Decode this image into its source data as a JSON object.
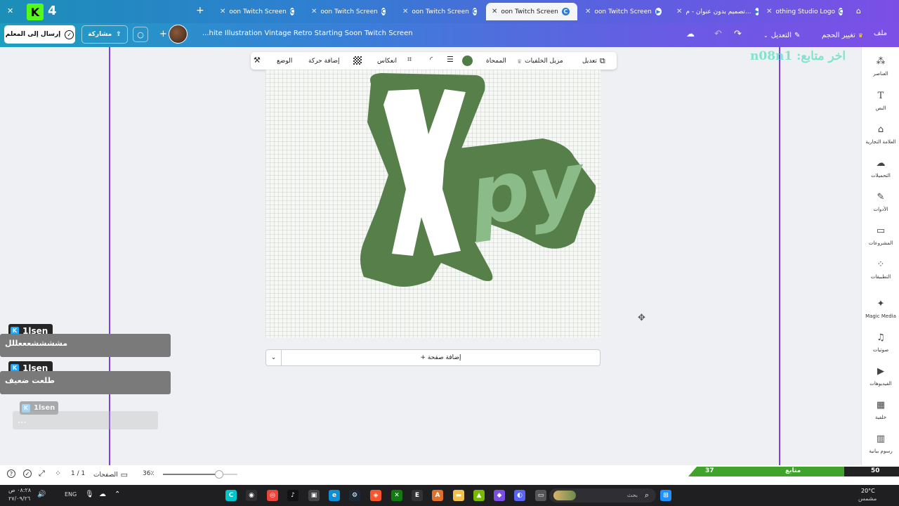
{
  "browser": {
    "counter": "4",
    "new_tab": "+",
    "tabs": [
      {
        "label": "oon Twitch Screen",
        "active": false
      },
      {
        "label": "oon Twitch Screen",
        "active": false
      },
      {
        "label": "oon Twitch Screen",
        "active": false
      },
      {
        "label": "oon Twitch Screen",
        "active": true
      },
      {
        "label": "oon Twitch Screen",
        "active": false
      },
      {
        "label": "تصميم بدون عنوان - م...",
        "active": false
      },
      {
        "label": "othing Studio Logo",
        "active": false
      }
    ]
  },
  "toolbar": {
    "file": "ملف",
    "resize": "تغيير الحجم",
    "edit": "التعديل",
    "doc_title": "...hite Illustration Vintage Retro Starting Soon Twitch Screen",
    "share": "مشاركة",
    "send_to_teacher": "إرسال إلى المعلم"
  },
  "context_toolbar": {
    "edit": "تعديل",
    "bg_remover": "مزيل الخلفيات",
    "eraser": "الممحاة",
    "flip": "انعكاس",
    "animate": "إضافة حركة",
    "position": "الوضع",
    "color": "#4f7d45"
  },
  "canvas": {
    "logo_letter": "X",
    "logo_text": "py",
    "logo_color": "#567f4a",
    "logo_light": "#8bbb88"
  },
  "add_page": "+ إضافة صفحة",
  "watermark": "n08n1 :اخر متابع",
  "chat": [
    {
      "user": "1lsen",
      "message": "مششششعععللل"
    },
    {
      "user": "1lsen",
      "message": "طلعت ضعيف"
    },
    {
      "user": "1lsen",
      "message": "..."
    }
  ],
  "sidebar": [
    {
      "label": "العناصر",
      "icon": "elements-icon"
    },
    {
      "label": "النص",
      "icon": "text-icon"
    },
    {
      "label": "العلامة التجارية",
      "icon": "brand-icon"
    },
    {
      "label": "التحميلات",
      "icon": "uploads-icon"
    },
    {
      "label": "الأدوات",
      "icon": "tools-icon"
    },
    {
      "label": "المشروعات",
      "icon": "projects-icon"
    },
    {
      "label": "التطبيقات",
      "icon": "apps-icon"
    },
    {
      "label": "Magic Media",
      "icon": "magic-media-icon"
    },
    {
      "label": "صوتيات",
      "icon": "audio-icon"
    },
    {
      "label": "الفيديوهات",
      "icon": "videos-icon"
    },
    {
      "label": "خلفية",
      "icon": "background-icon"
    },
    {
      "label": "رسوم بيانية",
      "icon": "charts-icon"
    }
  ],
  "status": {
    "zoom": "36٪",
    "zoom_fraction": 0.36,
    "pages_label": "الصفحات",
    "page_count": "1 / 1"
  },
  "followers": {
    "current": "37",
    "label": "متابع",
    "goal": "50",
    "progress": 0.74
  },
  "taskbar": {
    "search": "بحث",
    "lang": "ENG",
    "time": "٠٨:٢٨ ص",
    "date": "٢٧/٠٩/٢٦",
    "weather_temp": "20°C",
    "weather_desc": "مشمس"
  }
}
